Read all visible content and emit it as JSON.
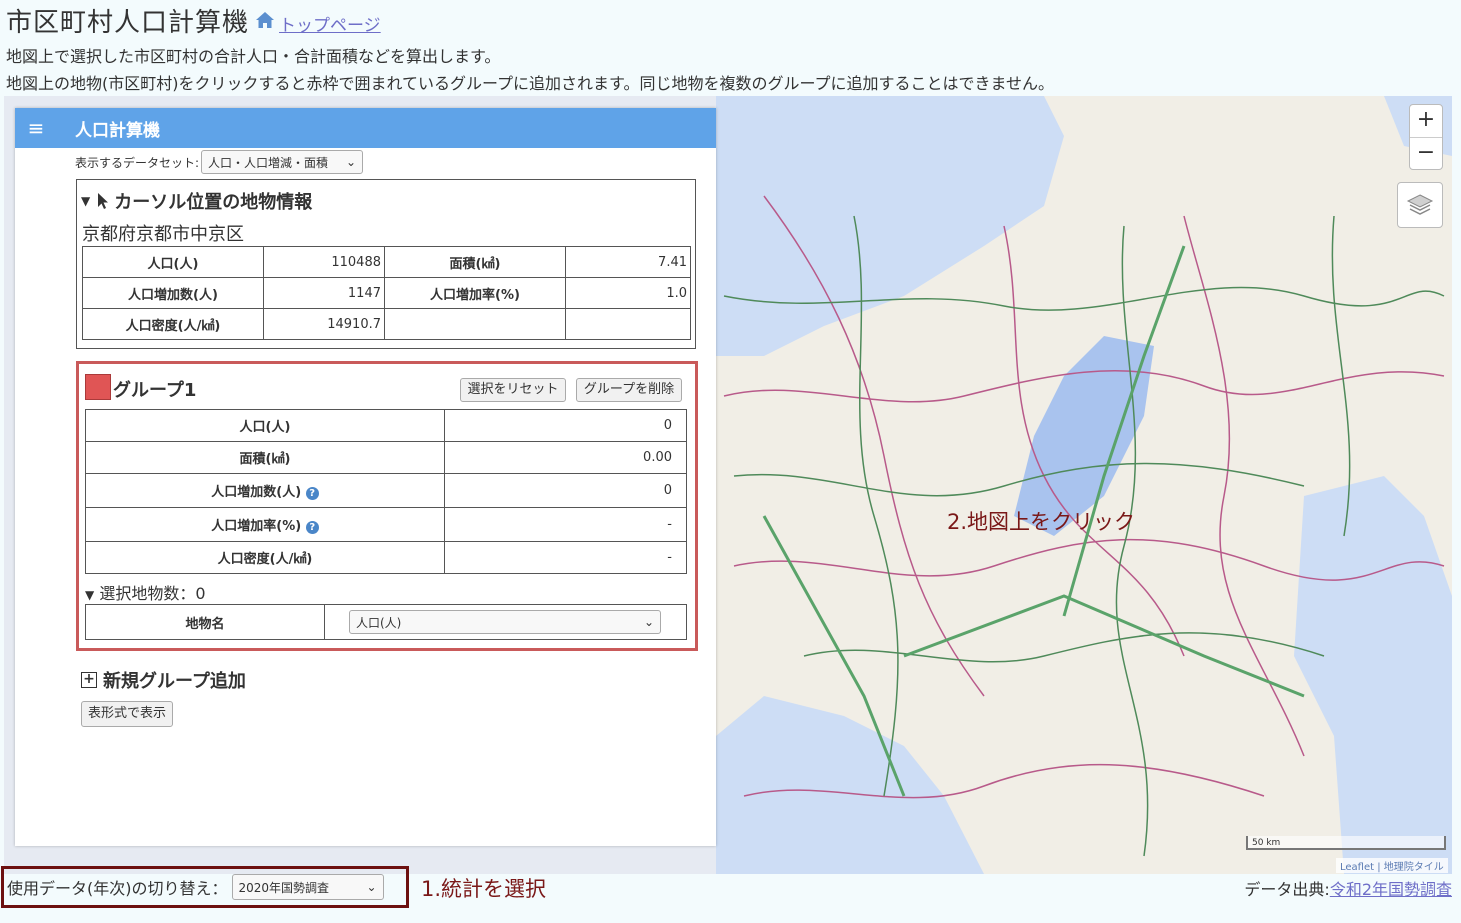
{
  "header": {
    "title": "市区町村人口計算機",
    "home_link": "トップページ",
    "desc1": "地図上で選択した市区町村の合計人口・合計面積などを算出します。",
    "desc2": "地図上の地物(市区町村)をクリックすると赤枠で囲まれているグループに追加されます。同じ地物を複数のグループに追加することはできません。"
  },
  "panel": {
    "title": "人口計算機",
    "dataset_label": "表示するデータセット:",
    "dataset_value": "人口・人口増減・面積",
    "cursor": {
      "heading": "カーソル位置の地物情報",
      "place": "京都府京都市中京区",
      "rows": [
        [
          "人口(人)",
          "110488",
          "面積(㎢)",
          "7.41"
        ],
        [
          "人口増加数(人)",
          "1147",
          "人口増加率(%)",
          "1.0"
        ],
        [
          "人口密度(人/㎢)",
          "14910.7",
          "",
          ""
        ]
      ]
    },
    "group": {
      "name": "グループ1",
      "reset": "選択をリセット",
      "delete": "グループを削除",
      "rows": [
        [
          "人口(人)",
          "0"
        ],
        [
          "面積(㎢)",
          "0.00"
        ],
        [
          "人口増加数(人)",
          "0"
        ],
        [
          "人口増加率(%)",
          "-"
        ],
        [
          "人口密度(人/㎢)",
          "-"
        ]
      ],
      "count_label": "選択地物数：0",
      "feature_header": "地物名",
      "feature_select": "人口(人)"
    },
    "new_group": "新規グループ追加",
    "table_btn": "表形式で表示"
  },
  "map": {
    "hint": "2.地図上をクリック",
    "zoom_in": "+",
    "zoom_out": "−",
    "scale": "50 km",
    "attrib_leaflet": "Leaflet",
    "attrib_tile": "地理院タイル"
  },
  "footer": {
    "switch_label": "使用データ(年次)の切り替え：",
    "year_value": "2020年国勢調査",
    "hint": "1.統計を選択",
    "source_label": "データ出典:",
    "source_link": "令和2年国勢調査"
  },
  "colors": {
    "panel_header": "#5fa3e8",
    "group_border": "#c95a5a",
    "group_swatch": "#e05555",
    "hint": "#7a1818",
    "link": "#6e6ec8"
  }
}
